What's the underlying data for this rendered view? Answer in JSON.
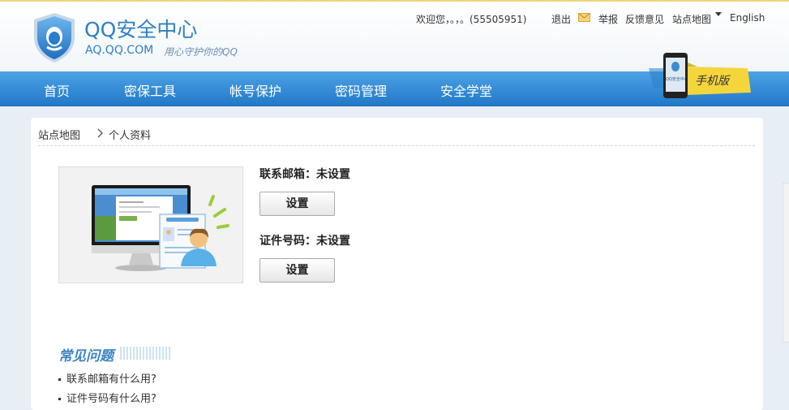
{
  "header": {
    "logo_title": "QQ安全中心",
    "logo_url": "AQ.QQ.COM",
    "slogan": "用心守护你的QQ"
  },
  "toplinks": {
    "welcome": "欢迎您，。，。(55505951)",
    "logout": "退出",
    "report": "举报",
    "feedback": "反馈意见",
    "sitemap": "站点地图",
    "english": "English"
  },
  "nav": {
    "items": [
      "首页",
      "密保工具",
      "帐号保护",
      "密码管理",
      "安全学堂"
    ]
  },
  "mobile_badge": {
    "label": "手机版",
    "phone_text": "QQ安全中心"
  },
  "breadcrumb": {
    "root": "站点地图",
    "current": "个人资料"
  },
  "profile": {
    "email_label": "联系邮箱：未设置",
    "email_button": "设置",
    "id_label": "证件号码：未设置",
    "id_button": "设置"
  },
  "faq": {
    "title": "常见问题",
    "items": [
      "联系邮箱有什么用?",
      "证件号码有什么用?"
    ]
  },
  "colors": {
    "brand_blue": "#2f7fc4",
    "nav_blue": "#2a80cd",
    "badge_yellow": "#f5d53c"
  }
}
